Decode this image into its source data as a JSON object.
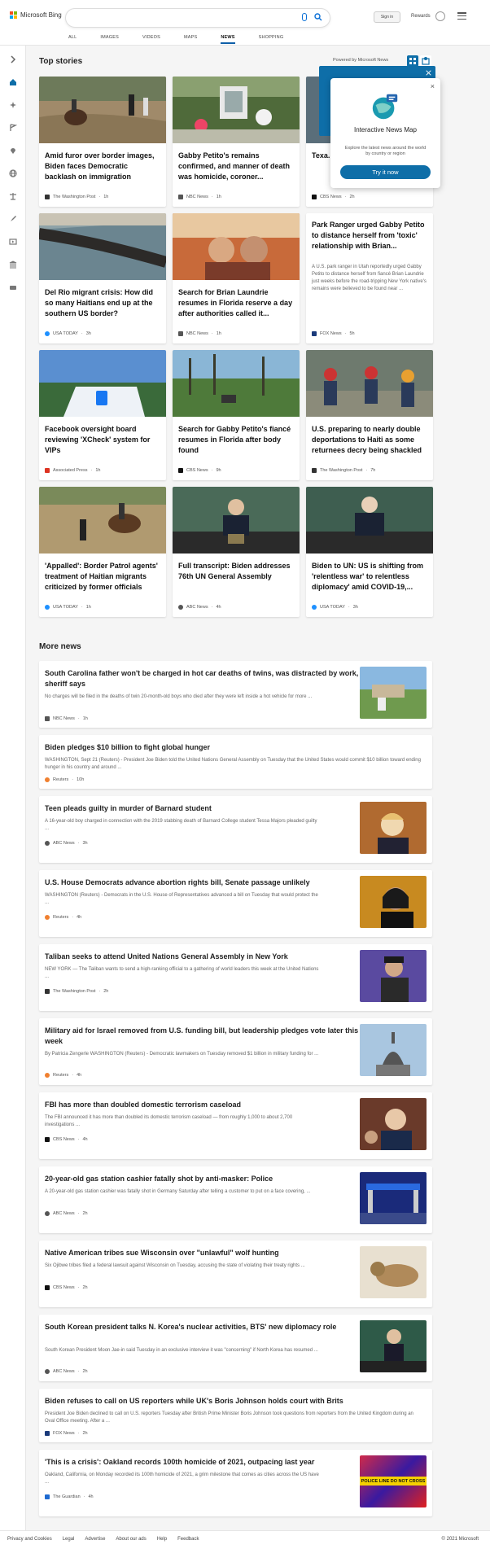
{
  "header": {
    "brand": "Microsoft Bing",
    "search_placeholder": "",
    "signin": "Sign in",
    "rewards": "Rewards",
    "tabs": [
      "ALL",
      "IMAGES",
      "VIDEOS",
      "MAPS",
      "NEWS",
      "SHOPPING"
    ],
    "active_tab": "NEWS"
  },
  "top_stories": {
    "heading": "Top stories",
    "powered_by": "Powered by Microsoft News",
    "cards": [
      {
        "title": "Amid furor over border images, Biden faces Democratic backlash on immigration",
        "source": "The Washington Post",
        "time": "1h"
      },
      {
        "title": "Gabby Petito's remains confirmed, and manner of death was homicide, coroner...",
        "source": "NBC News",
        "time": "1h"
      },
      {
        "title": "Texa... wom...",
        "source": "CBS News",
        "time": "2h"
      },
      {
        "title": "Del Rio migrant crisis: How did so many Haitians end up at the southern US border?",
        "source": "USA TODAY",
        "time": "3h"
      },
      {
        "title": "Search for Brian Laundrie resumes in Florida reserve a day after authorities called it...",
        "source": "NBC News",
        "time": "1h"
      },
      {
        "title": "Park Ranger urged Gabby Petito to distance herself from 'toxic' relationship with Brian...",
        "snippet": "A U.S. park ranger in Utah reportedly urged Gabby Petito to distance herself from fiancé Brian Laundrie just weeks before the road-tripping New York native's remains were believed to be found near ...",
        "source": "FOX News",
        "time": "5h"
      },
      {
        "title": "Facebook oversight board reviewing 'XCheck' system for VIPs",
        "source": "Associated Press",
        "time": "1h"
      },
      {
        "title": "Search for Gabby Petito's fiancé resumes in Florida after body found",
        "source": "CBS News",
        "time": "9h"
      },
      {
        "title": "U.S. preparing to nearly double deportations to Haiti as some returnees decry being shackled",
        "source": "The Washington Post",
        "time": "7h"
      },
      {
        "title": "'Appalled': Border Patrol agents' treatment of Haitian migrants criticized by former officials",
        "source": "USA TODAY",
        "time": "1h"
      },
      {
        "title": "Full transcript: Biden addresses 76th UN General Assembly",
        "source": "ABC News",
        "time": "4h"
      },
      {
        "title": "Biden to UN: US is shifting from 'relentless war' to relentless diplomacy' amid COVID-19,...",
        "source": "USA TODAY",
        "time": "3h"
      }
    ]
  },
  "popup": {
    "title": "Interactive News Map",
    "description": "Explore the latest news around the world by country or region",
    "button": "Try it now",
    "close": "×"
  },
  "more_news": {
    "heading": "More news",
    "items": [
      {
        "title": "South Carolina father won't be charged in hot car deaths of twins, was distracted by work, sheriff says",
        "snippet": "No charges will be filed in the deaths of twin 20-month-old boys who died after they were left inside a hot vehicle for more ...",
        "source": "NBC News",
        "time": "1h"
      },
      {
        "title": "Biden pledges $10 billion to fight global hunger",
        "snippet": "WASHINGTON, Sept 21 (Reuters) - President Joe Biden told the United Nations General Assembly on Tuesday that the United States would commit $10 billion toward ending hunger in his country and around ...",
        "source": "Reuters",
        "time": "10h"
      },
      {
        "title": "Teen pleads guilty in murder of Barnard student",
        "snippet": "A 16-year-old boy charged in connection with the 2019 stabbing death of Barnard College student Tessa Majors pleaded guilty ...",
        "source": "ABC News",
        "time": "3h"
      },
      {
        "title": "U.S. House Democrats advance abortion rights bill, Senate passage unlikely",
        "snippet": "WASHINGTON (Reuters) - Democrats in the U.S. House of Representatives advanced a bill on Tuesday that would protect the ...",
        "source": "Reuters",
        "time": "4h"
      },
      {
        "title": "Taliban seeks to attend United Nations General Assembly in New York",
        "snippet": "NEW YORK — The Taliban wants to send a high-ranking official to a gathering of world leaders this week at the United Nations ...",
        "source": "The Washington Post",
        "time": "2h"
      },
      {
        "title": "Military aid for Israel removed from U.S. funding bill, but leadership pledges vote later this week",
        "snippet": "By Patricia Zengerle WASHINGTON (Reuters) - Democratic lawmakers on Tuesday removed $1 billion in military funding for ...",
        "source": "Reuters",
        "time": "4h"
      },
      {
        "title": "FBI has more than doubled domestic terrorism caseload",
        "snippet": "The FBI announced it has more than doubled its domestic terrorism caseload — from roughly 1,000 to about 2,700 investigations ...",
        "source": "CBS News",
        "time": "4h"
      },
      {
        "title": "20-year-old gas station cashier fatally shot by anti-masker: Police",
        "snippet": "A 20-year-old gas station cashier was fatally shot in Germany Saturday after telling a customer to put on a face covering, ...",
        "source": "ABC News",
        "time": "2h"
      },
      {
        "title": "Native American tribes sue Wisconsin over \"unlawful\" wolf hunting",
        "snippet": "Six Ojibwe tribes filed a federal lawsuit against Wisconsin on Tuesday, accusing the state of violating their treaty rights ...",
        "source": "CBS News",
        "time": "2h"
      },
      {
        "title": "South Korean president talks N. Korea's nuclear activities, BTS' new diplomacy role",
        "snippet": "South Korean President Moon Jae-in said Tuesday in an exclusive interview it was \"concerning\" if North Korea has resumed ...",
        "source": "ABC News",
        "time": "2h"
      },
      {
        "title": "Biden refuses to call on US reporters while UK's Boris Johnson holds court with Brits",
        "snippet": "President Joe Biden declined to call on U.S. reporters Tuesday after British Prime Minister Boris Johnson took questions from reporters from the United Kingdom during an Oval Office meeting. After a ...",
        "source": "FOX News",
        "time": "2h"
      },
      {
        "title": "'This is a crisis': Oakland records 100th homicide of 2021, outpacing last year",
        "snippet": "Oakland, California, on Monday recorded its 100th homicide of 2021, a grim milestone that comes as cities across the US have ...",
        "source": "The Guardian",
        "time": "4h",
        "thumb_text": "POLICE LINE DO NOT CROSS"
      }
    ]
  },
  "footer": {
    "links": [
      "Privacy and Cookies",
      "Legal",
      "Advertise",
      "About our ads",
      "Help",
      "Feedback"
    ],
    "copyright": "© 2021 Microsoft"
  }
}
